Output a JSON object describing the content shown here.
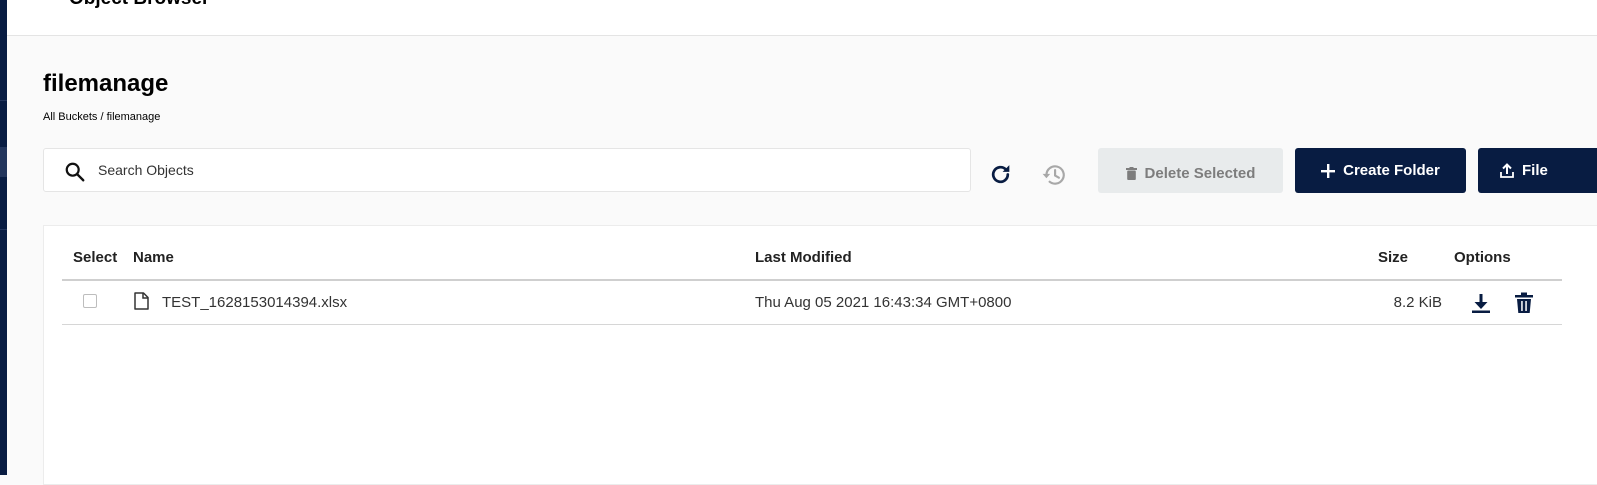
{
  "topbar": {
    "app_title": "Object Browser"
  },
  "bucket": {
    "title": "filemanage",
    "breadcrumb": "All Buckets / filemanage"
  },
  "search": {
    "placeholder": "Search Objects",
    "value": ""
  },
  "actions": {
    "delete_selected_label": "Delete Selected",
    "create_folder_label": "Create Folder",
    "upload_file_label": "File"
  },
  "table": {
    "columns": [
      "Select",
      "Name",
      "Last Modified",
      "Size",
      "Options"
    ],
    "rows": [
      {
        "name": "TEST_1628153014394.xlsx",
        "last_modified": "Thu Aug 05 2021 16:43:34 GMT+0800",
        "size": "8.2 KiB"
      }
    ]
  },
  "colors": {
    "primary": "#081c42",
    "disabled_button": "#e8ebec",
    "background": "#fafafa"
  },
  "icons": [
    "search-icon",
    "refresh-icon",
    "history-icon",
    "trash-icon",
    "plus-icon",
    "upload-icon",
    "file-icon",
    "download-icon"
  ]
}
